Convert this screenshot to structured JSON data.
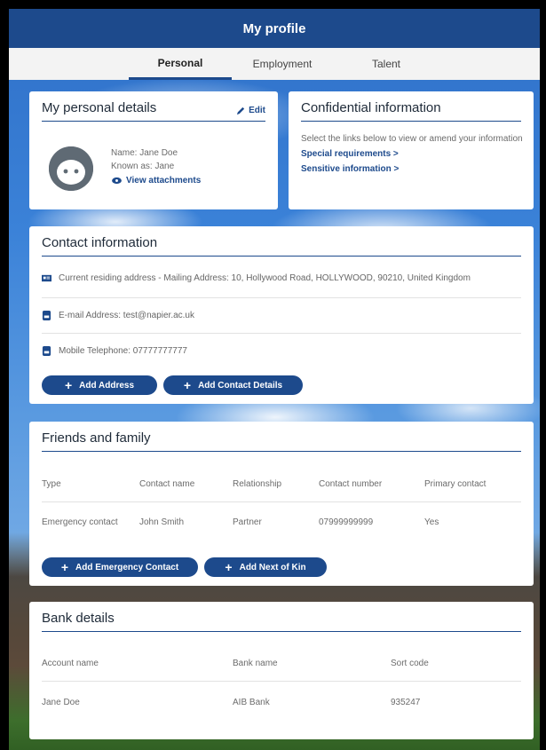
{
  "header": {
    "title": "My profile"
  },
  "tabs": [
    {
      "label": "Personal",
      "active": true
    },
    {
      "label": "Employment",
      "active": false
    },
    {
      "label": "Talent",
      "active": false
    }
  ],
  "personal_details": {
    "title": "My personal details",
    "edit_label": "Edit",
    "name_line": "Name: Jane Doe",
    "known_as_line": "Known as: Jane",
    "attachments_link": "View attachments"
  },
  "confidential": {
    "title": "Confidential information",
    "description": "Select the links below to view or amend your information",
    "links": [
      "Special requirements >",
      "Sensitive information >"
    ]
  },
  "contact": {
    "title": "Contact information",
    "rows": [
      {
        "icon": "address-card-icon",
        "text": "Current residing address - Mailing Address: 10, Hollywood Road, HOLLYWOOD, 90210, United Kingdom"
      },
      {
        "icon": "email-icon",
        "text": "E-mail Address: test@napier.ac.uk"
      },
      {
        "icon": "phone-icon",
        "text": "Mobile Telephone: 07777777777"
      }
    ],
    "buttons": [
      "Add Address",
      "Add Contact Details"
    ]
  },
  "friends": {
    "title": "Friends and family",
    "columns": [
      "Type",
      "Contact name",
      "Relationship",
      "Contact number",
      "Primary contact"
    ],
    "rows": [
      [
        "Emergency contact",
        "John Smith",
        "Partner",
        "07999999999",
        "Yes"
      ]
    ],
    "buttons": [
      "Add Emergency Contact",
      "Add Next of Kin"
    ]
  },
  "bank": {
    "title": "Bank details",
    "columns": [
      "Account name",
      "Bank name",
      "Sort code"
    ],
    "rows": [
      [
        "Jane Doe",
        "AIB Bank",
        "935247"
      ]
    ]
  },
  "colors": {
    "brand": "#1d4a8c",
    "text": "#1e2a38",
    "muted": "#6b6b6b"
  }
}
